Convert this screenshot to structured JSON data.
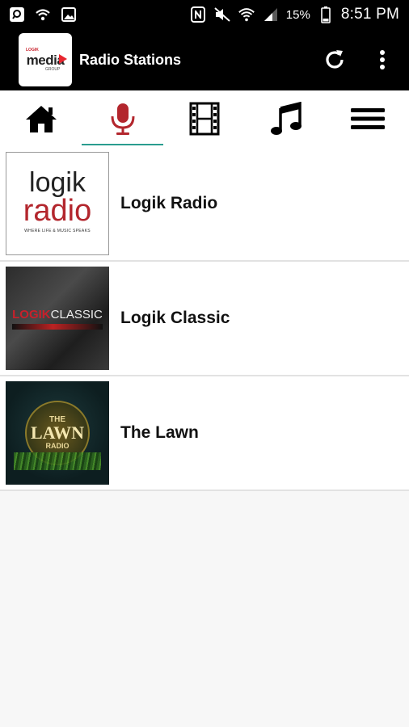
{
  "status_bar": {
    "battery_percent": "15%",
    "time": "8:51 PM"
  },
  "app_bar": {
    "logo": {
      "small_text": "LOGIK",
      "main_text": "media",
      "sub_text": "GROUP"
    },
    "title": "Radio Stations"
  },
  "tabs": [
    {
      "name": "home",
      "icon": "home-icon",
      "active": false
    },
    {
      "name": "radio",
      "icon": "microphone-icon",
      "active": true
    },
    {
      "name": "video",
      "icon": "film-icon",
      "active": false
    },
    {
      "name": "music",
      "icon": "music-note-icon",
      "active": false
    },
    {
      "name": "menu",
      "icon": "hamburger-menu-icon",
      "active": false
    }
  ],
  "colors": {
    "bar_bg": "#000000",
    "active_tab_icon": "#b3262d",
    "active_tab_indicator": "#2a9d8f",
    "list_bg": "#f7f7f7"
  },
  "stations": [
    {
      "name": "Logik Radio",
      "thumb": {
        "line1": "logik",
        "line2": "radio",
        "tagline": "WHERE LIFE & MUSIC SPEAKS"
      }
    },
    {
      "name": "Logik Classic",
      "thumb": {
        "title_red": "LOGIK",
        "title_rest": "CLASSIC"
      }
    },
    {
      "name": "The Lawn",
      "thumb": {
        "line1": "THE",
        "line2": "LAWN",
        "line3": "RADIO"
      }
    }
  ]
}
